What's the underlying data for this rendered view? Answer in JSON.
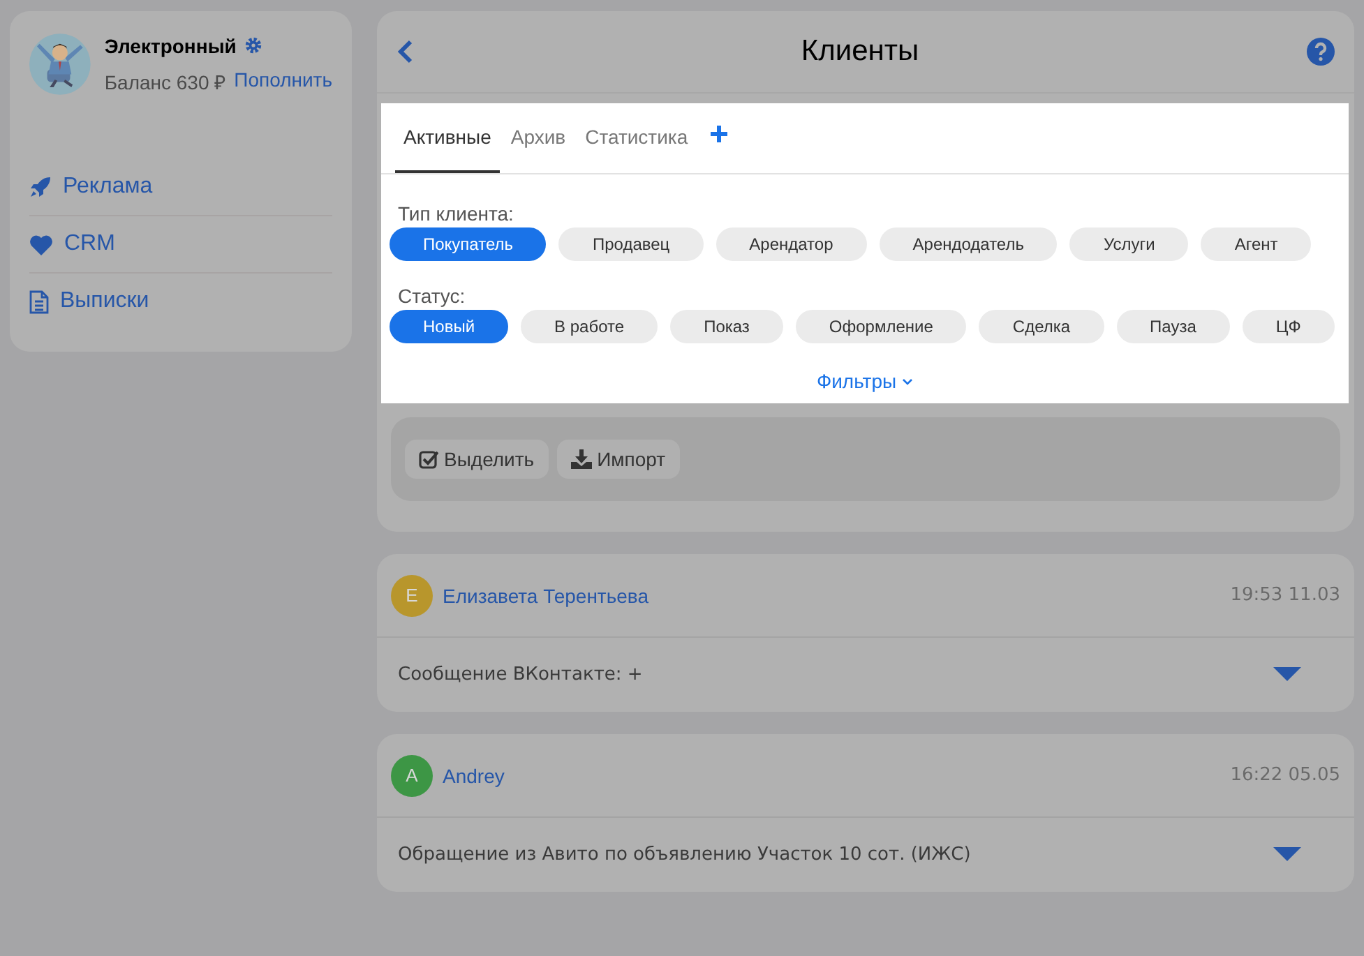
{
  "sidebar": {
    "user_name": "Электронный",
    "balance": "Баланс 630 ₽",
    "top_up": "Пополнить",
    "items": [
      {
        "kind": "rocket",
        "label": "Реклама"
      },
      {
        "kind": "heart",
        "label": "CRM"
      },
      {
        "kind": "document",
        "label": "Выписки"
      }
    ]
  },
  "header": {
    "title": "Клиенты"
  },
  "tabs": [
    {
      "label": "Активные",
      "selected": true
    },
    {
      "label": "Архив",
      "selected": false
    },
    {
      "label": "Статистика",
      "selected": false
    }
  ],
  "filters": {
    "groups": [
      {
        "label": "Тип клиента:",
        "chips": [
          {
            "label": "Покупатель",
            "selected": true
          },
          {
            "label": "Продавец",
            "selected": false
          },
          {
            "label": "Арендатор",
            "selected": false
          },
          {
            "label": "Арендодатель",
            "selected": false
          },
          {
            "label": "Услуги",
            "selected": false
          },
          {
            "label": "Агент",
            "selected": false
          }
        ]
      },
      {
        "label": "Статус:",
        "chips": [
          {
            "label": "Новый",
            "selected": true
          },
          {
            "label": "В работе",
            "selected": false
          },
          {
            "label": "Показ",
            "selected": false
          },
          {
            "label": "Оформление",
            "selected": false
          },
          {
            "label": "Сделка",
            "selected": false
          },
          {
            "label": "Пауза",
            "selected": false
          },
          {
            "label": "ЦФ",
            "selected": false
          }
        ]
      }
    ],
    "toggle": "Фильтры"
  },
  "toolbar": [
    {
      "kind": "select",
      "label": "Выделить"
    },
    {
      "kind": "import",
      "label": "Импорт"
    }
  ],
  "clients": [
    {
      "initial": "Е",
      "color": "#b8962c",
      "name": "Елизавета Терентьева",
      "time": "19:53 11.03",
      "message": "Сообщение ВКонтакте: +"
    },
    {
      "initial": "A",
      "color": "#3d9645",
      "name": "Andrey",
      "time": "16:22 05.05",
      "message": "Обращение из Авито по объявлению Участок 10 сот. (ИЖС)"
    }
  ]
}
